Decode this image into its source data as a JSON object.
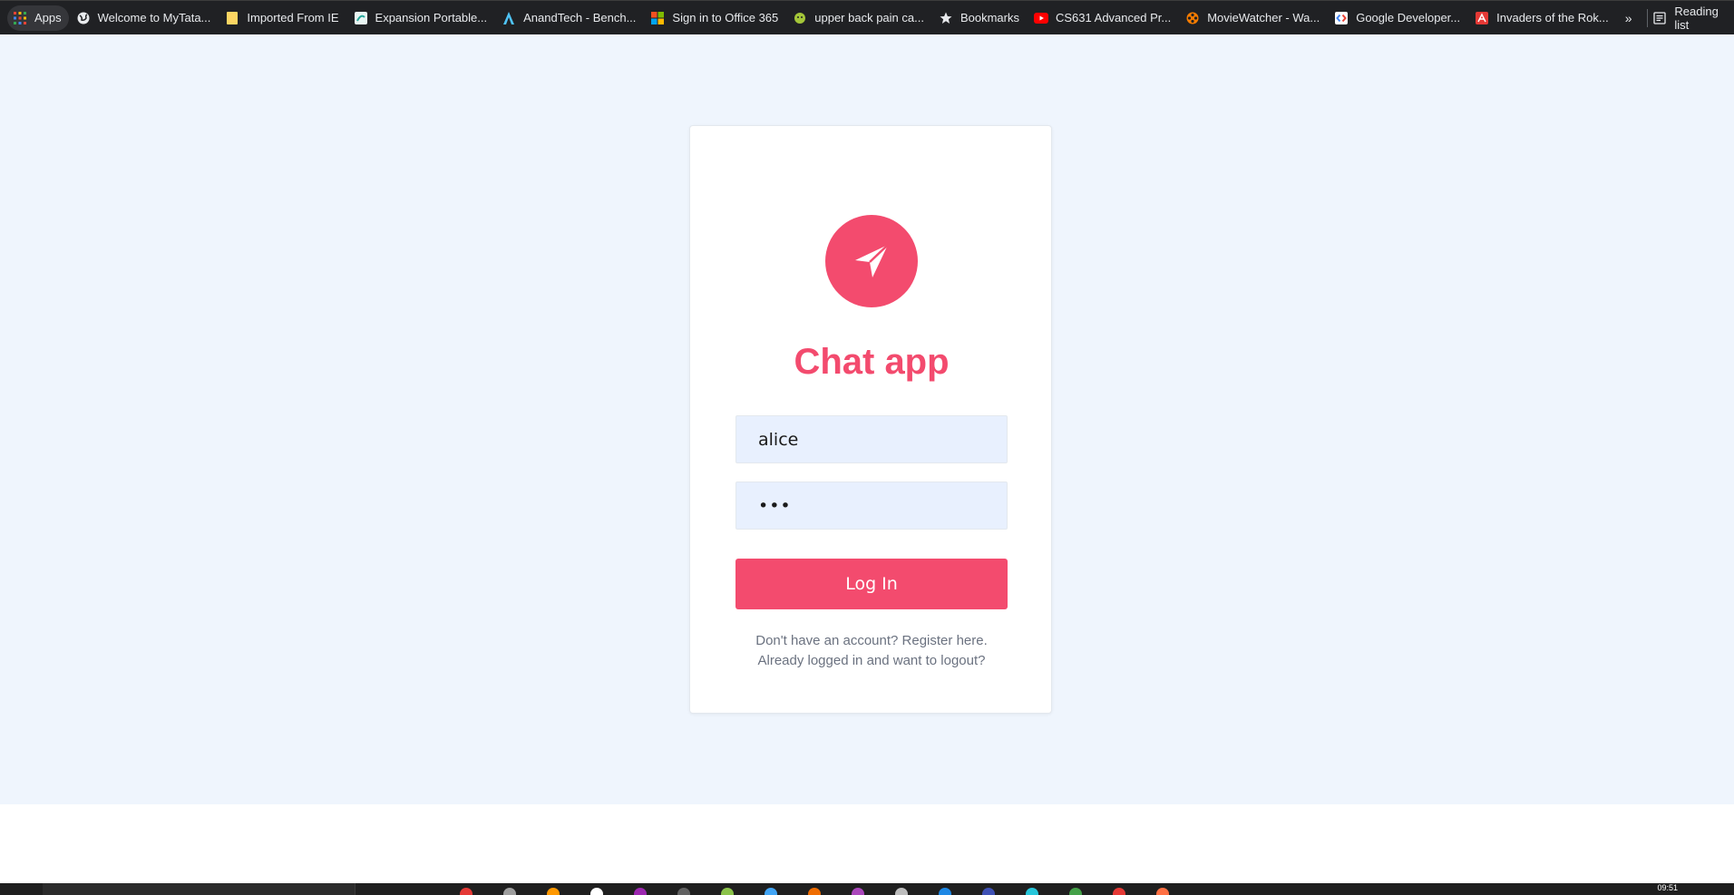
{
  "bookmarks_bar": {
    "items": [
      {
        "label": "Apps",
        "icon": "apps-grid-icon"
      },
      {
        "label": "Welcome to MyTata...",
        "icon": "globe-icon"
      },
      {
        "label": "Imported From IE",
        "icon": "folder-icon"
      },
      {
        "label": "Expansion Portable...",
        "icon": "seagate-icon"
      },
      {
        "label": "AnandTech - Bench...",
        "icon": "anandtech-icon"
      },
      {
        "label": "Sign in to Office 365",
        "icon": "microsoft-icon"
      },
      {
        "label": "upper back pain ca...",
        "icon": "android-icon"
      },
      {
        "label": "Bookmarks",
        "icon": "star-icon"
      },
      {
        "label": "CS631 Advanced Pr...",
        "icon": "youtube-icon"
      },
      {
        "label": "MovieWatcher - Wa...",
        "icon": "film-reel-icon"
      },
      {
        "label": "Google Developer...",
        "icon": "google-developers-icon"
      },
      {
        "label": "Invaders of the Rok...",
        "icon": "acrobat-icon"
      }
    ],
    "overflow_label": "»",
    "reading_list_label": "Reading list"
  },
  "login": {
    "logo_icon": "paper-plane-icon",
    "title": "Chat app",
    "username_value": "alice",
    "password_value": "•••",
    "login_button": "Log In",
    "register_link": "Don't have an account? Register here.",
    "logout_link": "Already logged in and want to logout?"
  },
  "taskbar": {
    "time": "09:51"
  },
  "colors": {
    "accent": "#f34b6e",
    "page_background": "#eff5fd",
    "input_background": "#e8f0fe",
    "bookmarks_bar": "#202124"
  }
}
